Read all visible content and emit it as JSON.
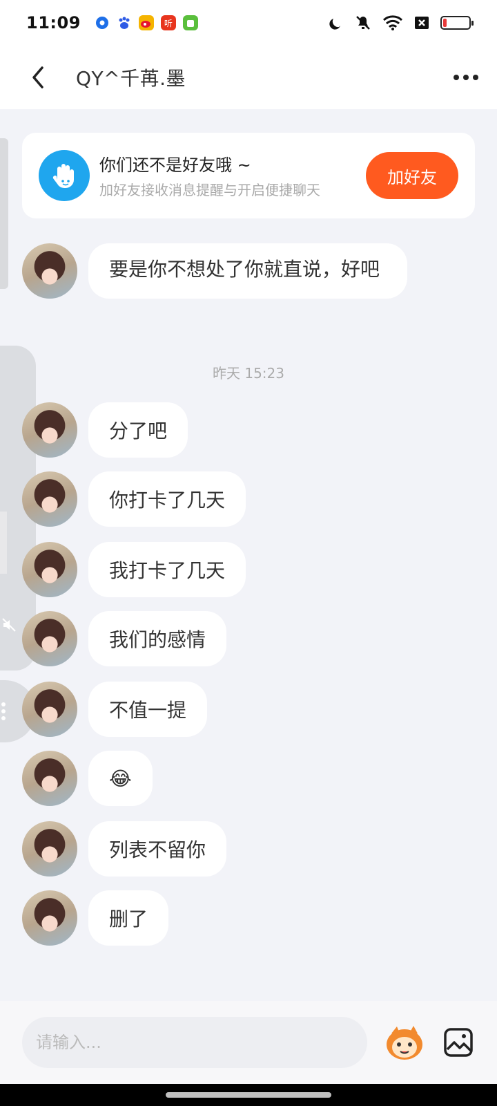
{
  "status_bar": {
    "time": "11:09",
    "notification_icons": [
      "app-blue-circle",
      "baidu",
      "weibo",
      "ting",
      "android-store"
    ],
    "listen_label": "听",
    "right_icons": [
      "moon-icon",
      "mute-icon",
      "wifi-icon",
      "sim-off-icon",
      "battery-low-icon"
    ],
    "battery_level": 0.15
  },
  "header": {
    "title": "QY^千苒.墨"
  },
  "friend_banner": {
    "title": "你们还不是好友哦 ~",
    "subtitle": "加好友接收消息提醒与开启便捷聊天",
    "button_label": "加好友",
    "accent": "#FF5A1F"
  },
  "messages": [
    {
      "text": "要是你不想处了你就直说，好吧"
    },
    {
      "text": "分了吧"
    },
    {
      "text": "你打卡了几天"
    },
    {
      "text": "我打卡了几天"
    },
    {
      "text": "我们的感情"
    },
    {
      "text": "不值一提"
    },
    {
      "text": "😂"
    },
    {
      "text": "列表不留你"
    },
    {
      "text": "删了"
    }
  ],
  "timestamp": "昨天 15:23",
  "input_bar": {
    "placeholder": "请输入..."
  }
}
